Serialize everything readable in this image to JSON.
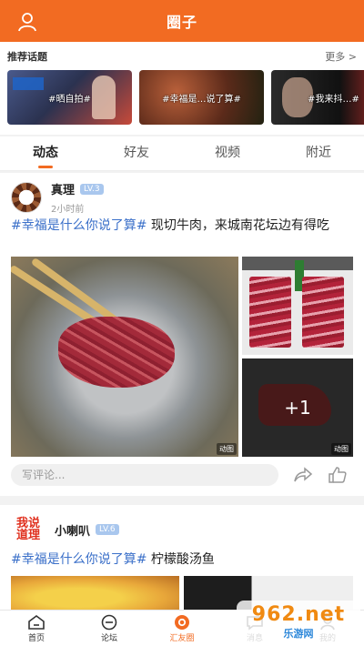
{
  "header": {
    "title": "圈子",
    "user_icon": "user-icon"
  },
  "topics": {
    "label": "推荐话题",
    "more": "更多 >",
    "cards": [
      {
        "title": "#晒自拍#"
      },
      {
        "title": "#幸福是…说了算#"
      },
      {
        "title": "#我来抖…#"
      }
    ]
  },
  "tabs": [
    {
      "label": "动态",
      "active": true
    },
    {
      "label": "好友"
    },
    {
      "label": "视频"
    },
    {
      "label": "附近"
    }
  ],
  "posts": [
    {
      "author": "真理",
      "level": "LV.3",
      "time": "2小时前",
      "tag": "#幸福是什么你说了算#",
      "text": "现切牛肉，来城南花坛边有得吃",
      "more_images": "+1",
      "badge": "动图",
      "comment_placeholder": "写评论..."
    },
    {
      "author": "小喇叭",
      "level": "LV.6",
      "avatar_text": [
        "我说",
        "道理"
      ],
      "tag": "#幸福是什么你说了算#",
      "text": "柠檬酸汤鱼"
    }
  ],
  "bottom_nav": [
    {
      "label": "首页",
      "icon": "home-icon"
    },
    {
      "label": "论坛",
      "icon": "forum-icon"
    },
    {
      "label": "汇友圈",
      "icon": "circle-icon",
      "active": true
    },
    {
      "label": "消息",
      "icon": "message-icon"
    },
    {
      "label": "我的",
      "icon": "profile-icon"
    }
  ],
  "watermark": {
    "big": "962.net",
    "small": "乐游网"
  },
  "colors": {
    "accent": "#f26b22",
    "tag": "#3b70c9",
    "level_badge": "#a9c7ee"
  }
}
